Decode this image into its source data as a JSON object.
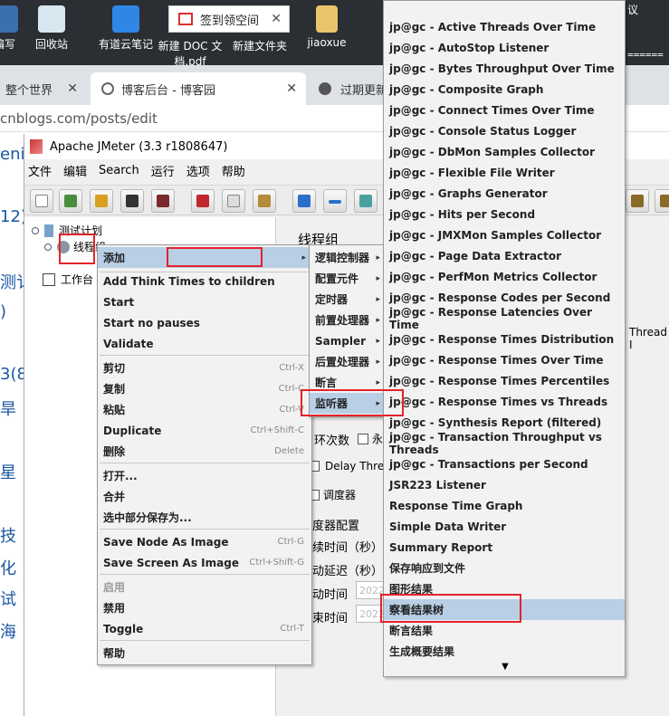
{
  "desktop": {
    "icons": [
      {
        "label": "编写",
        "icon": "editor-icon",
        "color": "#3a6fb0"
      },
      {
        "label": "回收站",
        "icon": "recycle-bin-icon",
        "color": "#d8e6ef"
      },
      {
        "label": "有道云笔记",
        "icon": "youdao-note-icon",
        "color": "#2f86e4"
      },
      {
        "label": "新建 DOC 文档.pdf",
        "icon": "pdf-file-icon",
        "color": "#e7e7e7"
      },
      {
        "label": "新建文件夹",
        "icon": "folder-icon",
        "color": "#e9c46a"
      },
      {
        "label": "jiaoxue",
        "icon": "folder-icon",
        "color": "#e9c46a"
      },
      {
        "label": "议",
        "icon": "",
        "color": "#2b2e33"
      }
    ],
    "notification": {
      "text": "签到领空间",
      "icon": "gift-icon",
      "close": "✕"
    },
    "terminal_fragment": "======"
  },
  "browser": {
    "tabs": [
      {
        "label": "整个世界",
        "close": "✕"
      },
      {
        "label": "博客后台 - 博客园",
        "close": "✕"
      },
      {
        "label": "过期更新",
        "close": ""
      }
    ],
    "address": "cnblogs.com/posts/edit"
  },
  "blog_fragments": [
    "eni",
    "12)",
    "测讠",
    ")",
    "3(8",
    "旱（",
    "星（",
    "技",
    "化",
    "试",
    "海"
  ],
  "jmeter": {
    "title": "Apache JMeter (3.3 r1808647)",
    "menu": [
      "文件",
      "编辑",
      "Search",
      "运行",
      "选项",
      "帮助"
    ],
    "tree": {
      "root": "测试计划",
      "thread_group": "线程组",
      "workbench": "工作台"
    },
    "right": {
      "title": "线程组",
      "labels": [
        "环次数",
        "Delay Threa",
        "调度器",
        "度器配置",
        "续时间（秒）",
        "动延迟（秒）",
        "动时间",
        "束时间"
      ],
      "forever": "永",
      "date_stub": "2022",
      "thread_label": "Thread I"
    }
  },
  "context_menu": {
    "items": [
      {
        "label": "添加",
        "arrow": "▸"
      },
      {
        "label": "Add Think Times to children"
      },
      {
        "label": "Start"
      },
      {
        "label": "Start no pauses"
      },
      {
        "label": "Validate"
      },
      {
        "label": "剪切",
        "shortcut": "Ctrl-X"
      },
      {
        "label": "复制",
        "shortcut": "Ctrl-C"
      },
      {
        "label": "粘贴",
        "shortcut": "Ctrl-V"
      },
      {
        "label": "Duplicate",
        "shortcut": "Ctrl+Shift-C"
      },
      {
        "label": "删除",
        "shortcut": "Delete"
      },
      {
        "label": "打开..."
      },
      {
        "label": "合并"
      },
      {
        "label": "选中部分保存为..."
      },
      {
        "label": "Save Node As Image",
        "shortcut": "Ctrl-G"
      },
      {
        "label": "Save Screen As Image",
        "shortcut": "Ctrl+Shift-G"
      },
      {
        "label": "启用"
      },
      {
        "label": "禁用"
      },
      {
        "label": "Toggle",
        "shortcut": "Ctrl-T"
      },
      {
        "label": "帮助"
      }
    ]
  },
  "add_submenu": {
    "items": [
      "逻辑控制器",
      "配置元件",
      "定时器",
      "前置处理器",
      "Sampler",
      "后置处理器",
      "断言",
      "监听器"
    ]
  },
  "listener_submenu": {
    "items": [
      "jp@gc - Active Threads Over Time",
      "jp@gc - AutoStop Listener",
      "jp@gc - Bytes Throughput Over Time",
      "jp@gc - Composite Graph",
      "jp@gc - Connect Times Over Time",
      "jp@gc - Console Status Logger",
      "jp@gc - DbMon Samples Collector",
      "jp@gc - Flexible File Writer",
      "jp@gc - Graphs Generator",
      "jp@gc - Hits per Second",
      "jp@gc - JMXMon Samples Collector",
      "jp@gc - Page Data Extractor",
      "jp@gc - PerfMon Metrics Collector",
      "jp@gc - Response Codes per Second",
      "jp@gc - Response Latencies Over Time",
      "jp@gc - Response Times Distribution",
      "jp@gc - Response Times Over Time",
      "jp@gc - Response Times Percentiles",
      "jp@gc - Response Times vs Threads",
      "jp@gc - Synthesis Report (filtered)",
      "jp@gc - Transaction Throughput vs Threads",
      "jp@gc - Transactions per Second",
      "JSR223 Listener",
      "Response Time Graph",
      "Simple Data Writer",
      "Summary Report",
      "保存响应到文件",
      "图形结果",
      "察看结果树",
      "断言结果",
      "生成概要结果"
    ],
    "scroll_up": "▲",
    "scroll_down": "▼"
  },
  "colors": {
    "highlight": "#b8cfe5",
    "annotation": "#e3242b"
  }
}
